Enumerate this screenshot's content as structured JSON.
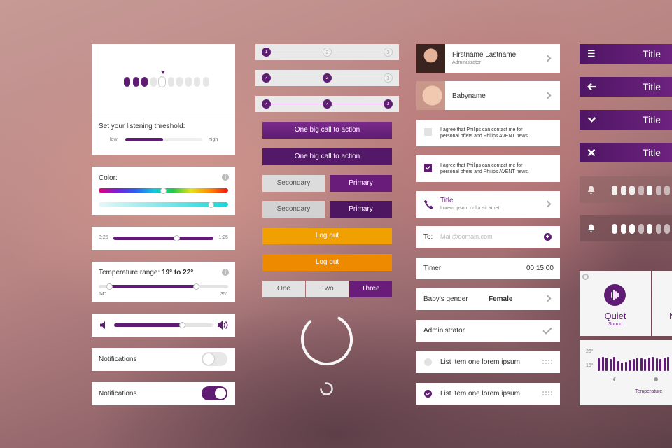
{
  "colors": {
    "brand_purple": "#6a1c7a",
    "dark_purple": "#4f1664",
    "orange": "#f0a000",
    "light_grey": "#e9e9ea"
  },
  "threshold": {
    "label": "Set your listening threshold:",
    "low": "low",
    "high": "high",
    "dots_total": 10,
    "dots_active": 3,
    "marker_index": 4
  },
  "color_picker": {
    "label": "Color:",
    "info_icon": "info-icon"
  },
  "player": {
    "elapsed": "3:25",
    "remaining": "-1:25",
    "progress": 0.62
  },
  "temperature": {
    "label": "Temperature range: ",
    "range_value": "19° to 22°",
    "min": "14°",
    "max": "35°"
  },
  "volume": {
    "level": 0.7
  },
  "toggles": [
    {
      "label": "Notifications",
      "on": false
    },
    {
      "label": "Notifications",
      "on": true
    }
  ],
  "steppers": [
    {
      "steps": [
        "1",
        "2",
        "3"
      ],
      "current": 1
    },
    {
      "steps": [
        "✓",
        "2",
        "3"
      ],
      "current": 2
    },
    {
      "steps": [
        "✓",
        "✓",
        "3"
      ],
      "current": 3
    }
  ],
  "buttons": {
    "cta": "One big call to action",
    "secondary": "Secondary",
    "primary": "Primary",
    "logout": "Log out",
    "segments": [
      "One",
      "Two",
      "Three"
    ],
    "selected_segment": "Three"
  },
  "list": {
    "profile": {
      "name": "Firstname Lastname",
      "role": "Administrator"
    },
    "baby": {
      "name": "Babyname"
    },
    "consent_text_1": "I agree that Philips can contact me for",
    "consent_text_2": "personal offers and Philips AVENT news.",
    "call": {
      "title": "Title",
      "subtitle": "Lorem ipsum dolor sit amet"
    },
    "mail": {
      "to_label": "To:",
      "placeholder": "Mail@domain.com"
    },
    "timer": {
      "label": "Timer",
      "value": "00:15:00"
    },
    "gender": {
      "label": "Baby's gender",
      "value": "Female"
    },
    "admin": {
      "label": "Administrator"
    },
    "items": [
      {
        "label": "List item one lorem ipsum",
        "selected": false
      },
      {
        "label": "List item one lorem ipsum",
        "selected": true
      }
    ]
  },
  "title_bars": [
    {
      "title": "Title",
      "icon": "menu-icon"
    },
    {
      "title": "Title",
      "icon": "back-arrow-icon"
    },
    {
      "title": "Title",
      "icon": "chevron-down-icon"
    },
    {
      "title": "Title",
      "icon": "close-icon"
    }
  ],
  "tile": {
    "title": "Quiet",
    "subtitle": "Sound",
    "next_letter": "N",
    "y_top": "26°",
    "y_bottom": "16°",
    "caption": "Temperature"
  }
}
